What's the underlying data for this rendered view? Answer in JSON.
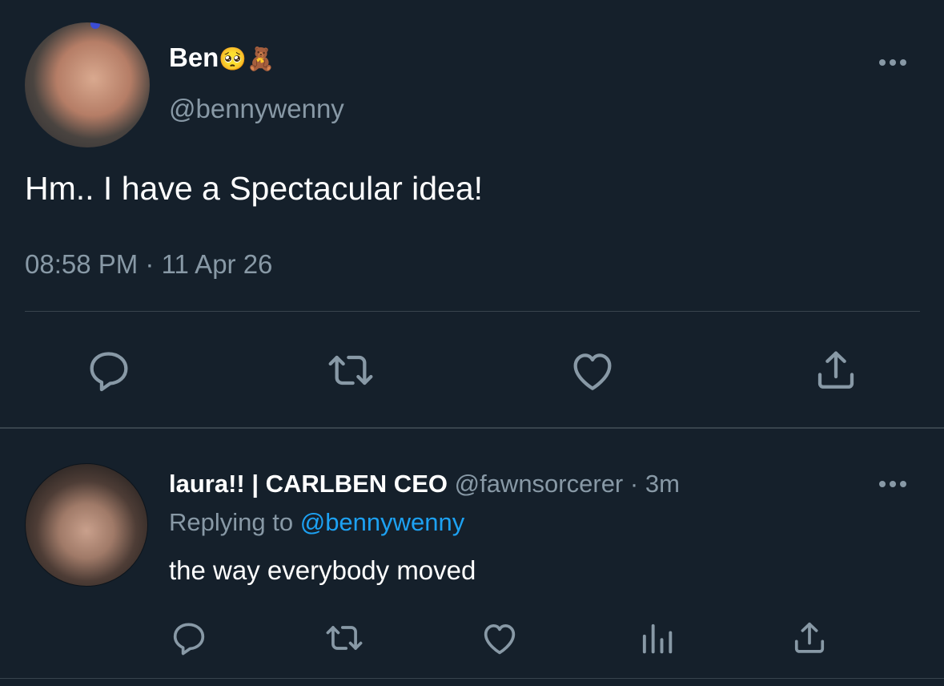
{
  "main_tweet": {
    "display_name": "Ben",
    "name_emojis": "🥺🧸",
    "handle": "@bennywenny",
    "text": "Hm.. I have a Spectacular idea!",
    "timestamp": "08:58 PM · 11 Apr 26",
    "actions": [
      "reply-icon",
      "retweet-icon",
      "like-icon",
      "share-icon"
    ]
  },
  "reply_tweet": {
    "display_name": "laura!! | CARLBEN CEO",
    "handle": "@fawnsorcerer",
    "separator": " · ",
    "time": "3m",
    "replying_prefix": "Replying to ",
    "replying_to": "@bennywenny",
    "text": "the way everybody moved",
    "actions": [
      "reply-icon",
      "retweet-icon",
      "like-icon",
      "analytics-icon",
      "share-icon"
    ]
  },
  "colors": {
    "background": "#15202b",
    "text_primary": "#ffffff",
    "text_secondary": "#8899a6",
    "accent": "#1da1f2",
    "divider": "#38444d"
  }
}
